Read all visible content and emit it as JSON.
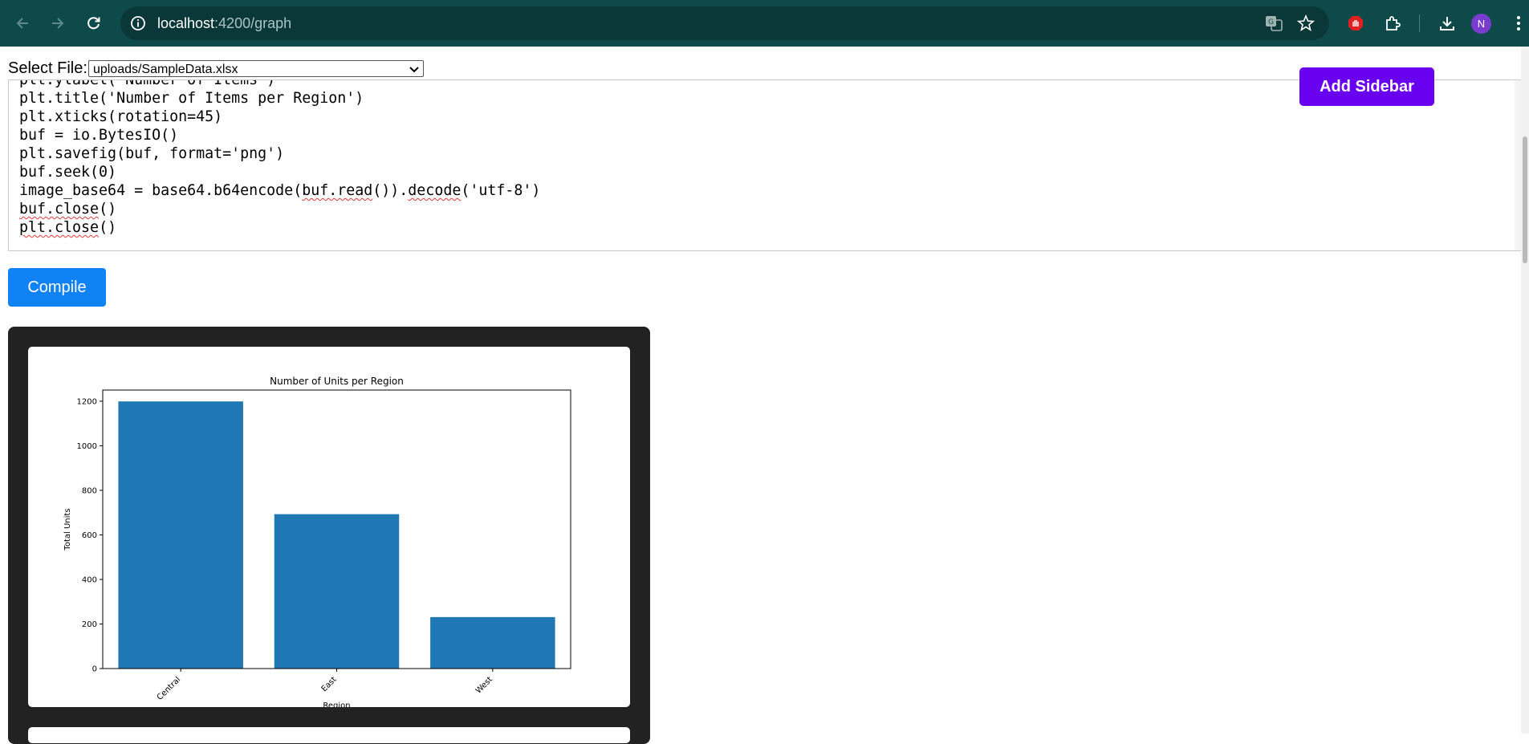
{
  "browser": {
    "url_host": "localhost",
    "url_path": ":4200/graph",
    "avatar_letter": "N"
  },
  "controls": {
    "select_label": "Select File:",
    "selected_file": "uploads/SampleData.xlsx",
    "add_sidebar_label": "Add Sidebar",
    "compile_label": "Compile"
  },
  "code_lines": [
    "plt.ylabel('Number of Items')",
    "plt.title('Number of Items per Region')",
    "plt.xticks(rotation=45)",
    "buf = io.BytesIO()",
    "plt.savefig(buf, format='png')",
    "buf.seek(0)",
    "image_base64 = base64.b64encode(buf.read()).decode('utf-8')",
    "buf.close()",
    "plt.close()"
  ],
  "chart_data": {
    "type": "bar",
    "title": "Number of Units per Region",
    "xlabel": "Region",
    "ylabel": "Total Units",
    "categories": [
      "Central",
      "East",
      "West"
    ],
    "values": [
      1199,
      693,
      231
    ],
    "ylim": [
      0,
      1250
    ],
    "yticks": [
      0,
      200,
      400,
      600,
      800,
      1000,
      1200
    ],
    "bar_color": "#1f77b4",
    "grid": false
  },
  "colors": {
    "chrome": "#0f4a4b",
    "add_sidebar": "#6a00f0",
    "compile": "#1182f5",
    "panel": "#222222"
  }
}
